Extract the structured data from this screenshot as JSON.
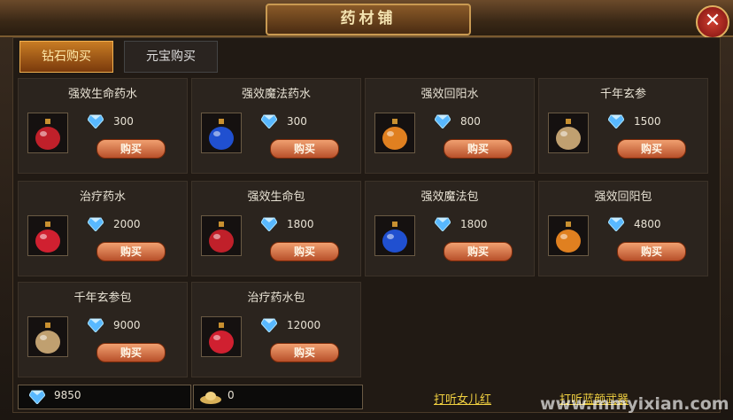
{
  "title": "药材铺",
  "tabs": [
    {
      "label": "钻石购买",
      "active": true
    },
    {
      "label": "元宝购买",
      "active": false
    }
  ],
  "items": [
    {
      "name": "强效生命药水",
      "price": "300",
      "icon": "red-potion-icon",
      "color": "#c0202a"
    },
    {
      "name": "强效魔法药水",
      "price": "300",
      "icon": "blue-potion-icon",
      "color": "#2050d0"
    },
    {
      "name": "强效回阳水",
      "price": "800",
      "icon": "orange-potion-icon",
      "color": "#e08020"
    },
    {
      "name": "千年玄参",
      "price": "1500",
      "icon": "ginseng-icon",
      "color": "#c0a070"
    },
    {
      "name": "治疗药水",
      "price": "2000",
      "icon": "healing-potion-icon",
      "color": "#d02030"
    },
    {
      "name": "强效生命包",
      "price": "1800",
      "icon": "red-potion-pack-icon",
      "color": "#c0202a"
    },
    {
      "name": "强效魔法包",
      "price": "1800",
      "icon": "blue-potion-pack-icon",
      "color": "#2050d0"
    },
    {
      "name": "强效回阳包",
      "price": "4800",
      "icon": "orange-potion-pack-icon",
      "color": "#e08020"
    },
    {
      "name": "千年玄参包",
      "price": "9000",
      "icon": "ginseng-pack-icon",
      "color": "#c0a070"
    },
    {
      "name": "治疗药水包",
      "price": "12000",
      "icon": "healing-potion-pack-icon",
      "color": "#d02030"
    }
  ],
  "buy_label": "购买",
  "currency": {
    "diamonds": "9850",
    "ingots": "0"
  },
  "links": {
    "left": "打听女儿红",
    "right": "打听蓝颜武器"
  },
  "watermark": "www.mmyixian.com"
}
